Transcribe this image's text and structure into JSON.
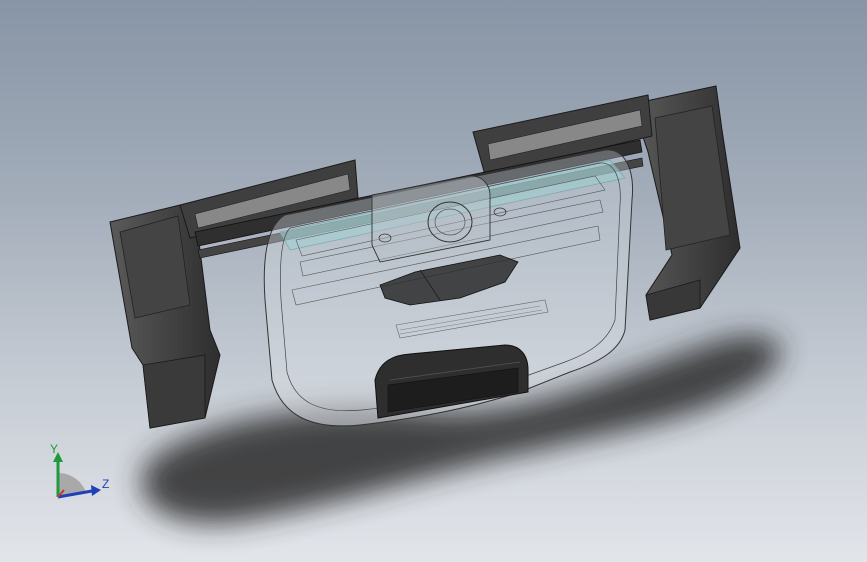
{
  "view": {
    "background_top": "#8895a6",
    "background_bottom": "#e2e5ea"
  },
  "model": {
    "part_color": "#3c3c3c",
    "shell_style": "transparent-wireframe",
    "accent_color": "#7fd0cc"
  },
  "triad": {
    "y_label": "Y",
    "z_label": "Z",
    "y_color": "#1e9a3a",
    "z_color": "#2040b8",
    "x_color": "#c0392b"
  }
}
